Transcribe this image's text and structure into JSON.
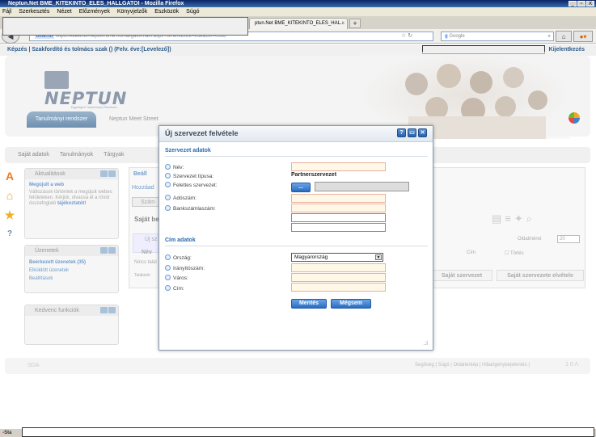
{
  "browser": {
    "window_title": "Neptun.Net BME_KITEKINTO_ELES_HALLGATOI - Mozilla Firefox",
    "window_buttons": [
      "_",
      "▫",
      "X"
    ],
    "menu": [
      "Fájl",
      "Szerkesztés",
      "Nézet",
      "Előzmények",
      "Könyvjelzők",
      "Eszközök",
      "Súgó"
    ],
    "tab_label": "ptun.Net BME_KITEKINTO_ELES_HAL...",
    "tab_close": "×",
    "new_tab": "+",
    "url_domain": "bme.hu",
    "url_text": "https://kitekinto-neptun.bme.hu/hallgato/main.aspx?ismenuclick=true&ctrl=0318",
    "search_placeholder": "Google",
    "search_icon": "magnifier-icon",
    "home_icon": "home-icon"
  },
  "page": {
    "breadcrumb": "Képzés | Szakfordító és tolmács szak () (Felv. éve:[Levelező])",
    "login_link": "Kijelentkezés",
    "logo_text": "NEPTUN",
    "logo_subtitle": "Egységes Tanulmányi Rendszer",
    "tabs": [
      "Tanulmányi rendszer",
      "Neptun Meet Street"
    ],
    "menu": [
      "Saját adatok",
      "Tanulmányok",
      "Tárgyak"
    ],
    "panels": {
      "news_title": "Aktualitások",
      "news_item_title": "Megújult a web",
      "news_item_text": "Változások történtek a megújult webes felületeken. Kérjük, olvassa el a rövid összefoglaló",
      "news_item_link": "tájékoztatót!",
      "messages_title": "Üzenetek",
      "messages_items": [
        "Beérkezett üzenetek (35)",
        "Elküldött üzenetek",
        "Beállítások"
      ],
      "favorites_title": "Kedvenc funkciók"
    },
    "main": {
      "heading": "Beáll",
      "add_label": "Hozzáad",
      "subtab": "Szám",
      "subheading": "Saját be",
      "inner_tab": "Új sz",
      "col_name": "Név",
      "no_result": "Nincs talál",
      "page_size_label": "Oldalméret",
      "page_size": "20",
      "col_address": "Cím",
      "col_delete": "Törlés",
      "btn_own_org": "Saját szervezet",
      "btn_own_org_remove": "Saját szervezete elvétele",
      "footer_label": "Találatok"
    },
    "footer": {
      "links": "Segítség | Súgó | Oldaltérkép | Hiba/igénybejelentés |",
      "logo": "1 0 Λ",
      "left": "SDA"
    },
    "taskbar_start": "Sta"
  },
  "modal": {
    "title": "Új szervezet felvétele",
    "buttons": [
      "?",
      "▭",
      "✕"
    ],
    "section_org": "Szervezet adatok",
    "field_name": "Név:",
    "field_type": "Szervezet típusa:",
    "type_value": "Partnerszervezet",
    "field_parent": "Felettes szervezet:",
    "parent_button": "...",
    "field_tax": "Adószám:",
    "field_bank": "Bankszámlaszám:",
    "section_address": "Cím adatok",
    "field_country": "Ország:",
    "country_value": "Magyarország",
    "field_zip": "Irányítószám:",
    "field_city": "Város:",
    "field_address": "Cím:",
    "save": "Mentés",
    "cancel": "Mégsem",
    "resize_glyph": ".:i"
  }
}
